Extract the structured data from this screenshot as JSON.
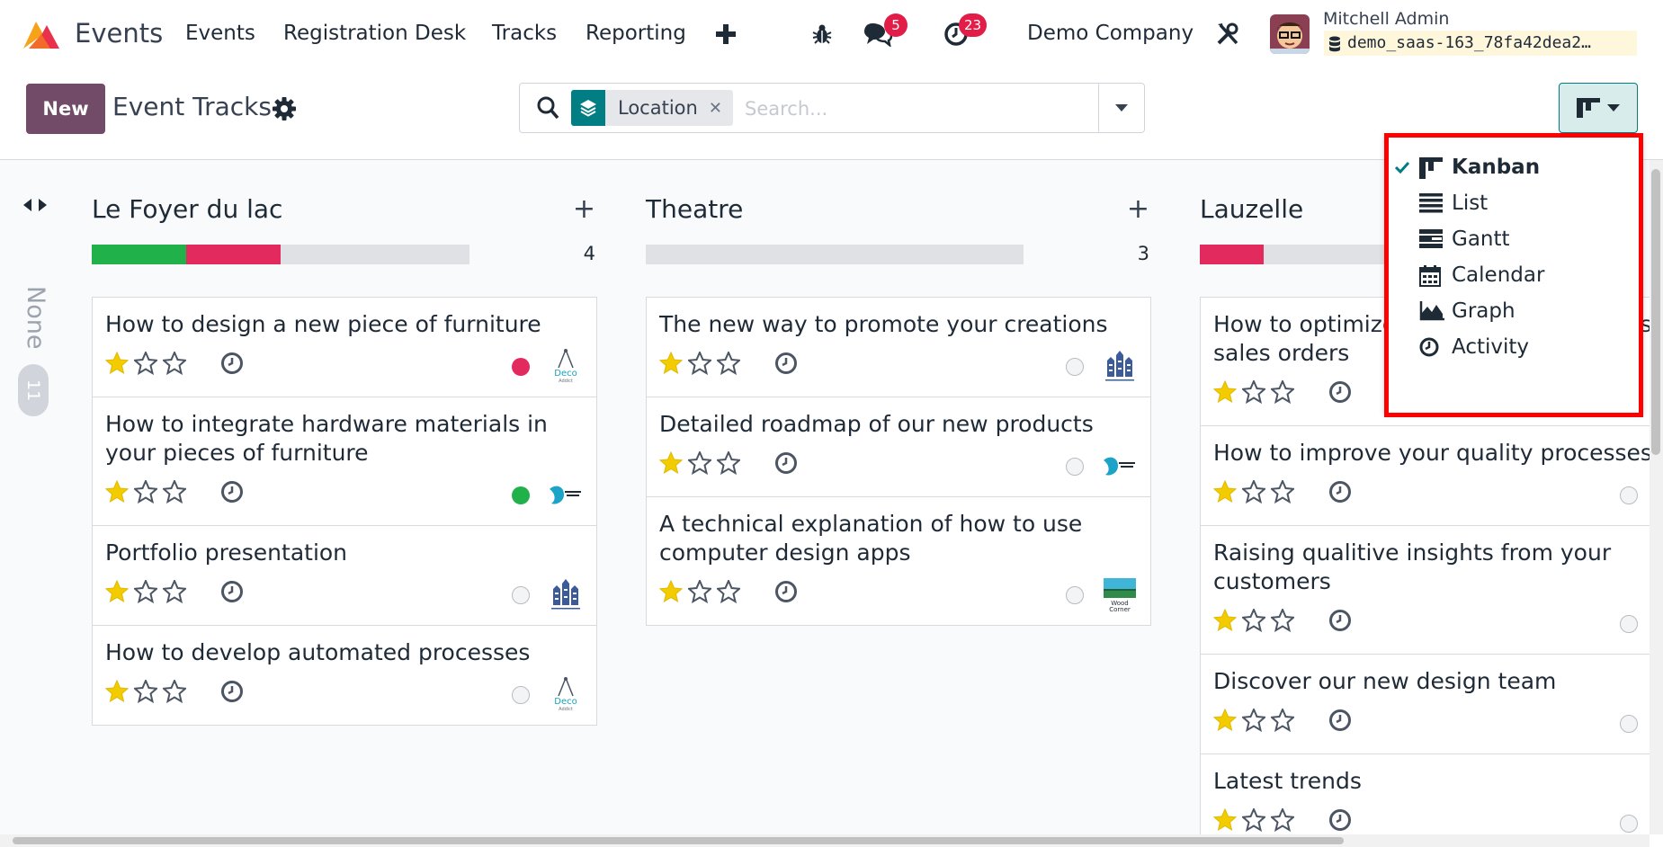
{
  "topbar": {
    "app_name": "Events",
    "menu": [
      "Events",
      "Registration Desk",
      "Tracks",
      "Reporting"
    ],
    "messages_badge": "5",
    "activities_badge": "23",
    "company": "Demo Company",
    "user_name": "Mitchell Admin",
    "database": "demo_saas-163_78fa42dea2…"
  },
  "control": {
    "new_label": "New",
    "title": "Event Tracks",
    "facet": "Location",
    "facet_remove": "✕",
    "search_placeholder": "Search..."
  },
  "sidebar": {
    "folded_label": "None",
    "folded_count": "11"
  },
  "columns": [
    {
      "title": "Le Foyer du lac",
      "count": "4",
      "progress": [
        {
          "color": "#21b14b",
          "fraction": 0.25
        },
        {
          "color": "#e22a5f",
          "fraction": 0.25
        }
      ],
      "cards": [
        {
          "title": "How to design a new piece of furniture",
          "stars": 1,
          "status": "red",
          "logo": "deco-addict-logo"
        },
        {
          "title": "How to integrate hardware materials in your pieces of furniture",
          "stars": 1,
          "status": "green",
          "logo": "gemini-furniture-logo"
        },
        {
          "title": "Portfolio presentation",
          "stars": 1,
          "status": "grey",
          "logo": "ready-mat-logo"
        },
        {
          "title": "How to develop automated processes",
          "stars": 1,
          "status": "grey",
          "logo": "deco-addict-logo"
        }
      ]
    },
    {
      "title": "Theatre",
      "count": "3",
      "progress": [],
      "cards": [
        {
          "title": "The new way to promote your creations",
          "stars": 1,
          "status": "grey",
          "logo": "ready-mat-logo"
        },
        {
          "title": "Detailed roadmap of our new products",
          "stars": 1,
          "status": "grey",
          "logo": "gemini-furniture-logo"
        },
        {
          "title": "A technical explanation of how to use computer design apps",
          "stars": 1,
          "status": "grey",
          "logo": "wood-corner-logo"
        }
      ]
    },
    {
      "title": "Lauzelle",
      "count": "",
      "progress": [
        {
          "color": "#e22a5f",
          "fraction": 0.17
        }
      ],
      "cards": [
        {
          "title": "How to optimize your sales, from leads to sales orders",
          "stars": 1,
          "status": "red",
          "logo": ""
        },
        {
          "title": "How to improve your quality processes",
          "stars": 1,
          "status": "grey",
          "logo": ""
        },
        {
          "title": "Raising qualitive insights from your customers",
          "stars": 1,
          "status": "grey",
          "logo": ""
        },
        {
          "title": "Discover our new design team",
          "stars": 1,
          "status": "grey",
          "logo": ""
        },
        {
          "title": "Latest trends",
          "stars": 1,
          "status": "grey",
          "logo": ""
        }
      ]
    }
  ],
  "logo_text": {
    "deco": "Deco",
    "deco_sub": "Addict",
    "wood": "Wood",
    "wood_sub": "Corner"
  },
  "view_menu": {
    "items": [
      {
        "label": "Kanban",
        "icon": "kanban-icon",
        "active": true
      },
      {
        "label": "List",
        "icon": "list-icon",
        "active": false
      },
      {
        "label": "Gantt",
        "icon": "gantt-icon",
        "active": false
      },
      {
        "label": "Calendar",
        "icon": "calendar-icon",
        "active": false
      },
      {
        "label": "Graph",
        "icon": "graph-icon",
        "active": false
      },
      {
        "label": "Activity",
        "icon": "activity-icon",
        "active": false
      }
    ]
  },
  "colors": {
    "brand": "#714b67",
    "accent": "#017e84",
    "status_red": "#e22a5f",
    "status_green": "#21b14b",
    "star": "#f3cc00",
    "highlight": "#ff0000"
  }
}
